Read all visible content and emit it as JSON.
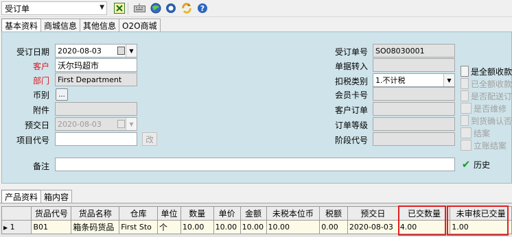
{
  "toolbar": {
    "doc_type": "受订单",
    "icons": [
      "exit-icon",
      "keyboard-icon",
      "globe-icon",
      "record-icon",
      "refresh-icon",
      "help-icon"
    ]
  },
  "tabs": [
    "基本资料",
    "商城信息",
    "其他信息",
    "O2O商城"
  ],
  "form": {
    "order_date_label": "受订日期",
    "order_date": "2020-08-03",
    "customer_label": "客户",
    "customer": "沃尔玛超市",
    "dept_label": "部门",
    "dept": "First Department",
    "currency_label": "币别",
    "currency_btn": "...",
    "attachment_label": "附件",
    "delivery_label": "预交日",
    "delivery_date": "2020-08-03",
    "project_label": "项目代号",
    "project_btn": "改",
    "order_no_label": "受订单号",
    "order_no": "SO08030001",
    "transfer_label": "单据转入",
    "tax_label": "扣税类别",
    "tax_value": "1.不计税",
    "member_label": "会员卡号",
    "cust_order_label": "客户订单",
    "level_label": "订单等级",
    "stage_label": "阶段代号",
    "remark_label": "备注"
  },
  "checks": [
    {
      "label": "是全额收款",
      "disabled": false,
      "checked": false
    },
    {
      "label": "已全额收款",
      "disabled": true,
      "checked": false
    },
    {
      "label": "是否配送订",
      "disabled": true,
      "checked": false
    },
    {
      "label": "是否维修",
      "disabled": true,
      "checked": false
    },
    {
      "label": "到货确认否",
      "disabled": true,
      "checked": false
    },
    {
      "label": "结案",
      "disabled": true,
      "checked": false
    },
    {
      "label": "立账结案",
      "disabled": true,
      "checked": false
    },
    {
      "label": "历史",
      "disabled": false,
      "checked": true
    }
  ],
  "bottom_tabs": [
    "产品资料",
    "箱内容"
  ],
  "grid": {
    "headers": [
      "货品代号",
      "货品名称",
      "仓库",
      "单位",
      "数量",
      "单价",
      "金额",
      "未税本位币",
      "税额",
      "预交日",
      "已交数量",
      "未审核已交量"
    ],
    "row_no": "1",
    "row": [
      "B01",
      "箱条码货品",
      "First Sto",
      "个",
      "10.00",
      "10.00",
      "10.00",
      "10.00",
      "0.00",
      "2020-08-03",
      "4.00",
      "1.00"
    ]
  },
  "colors": {
    "panel": "#cfe4ea",
    "required_label": "#e0141e",
    "highlight": "#e02020"
  }
}
